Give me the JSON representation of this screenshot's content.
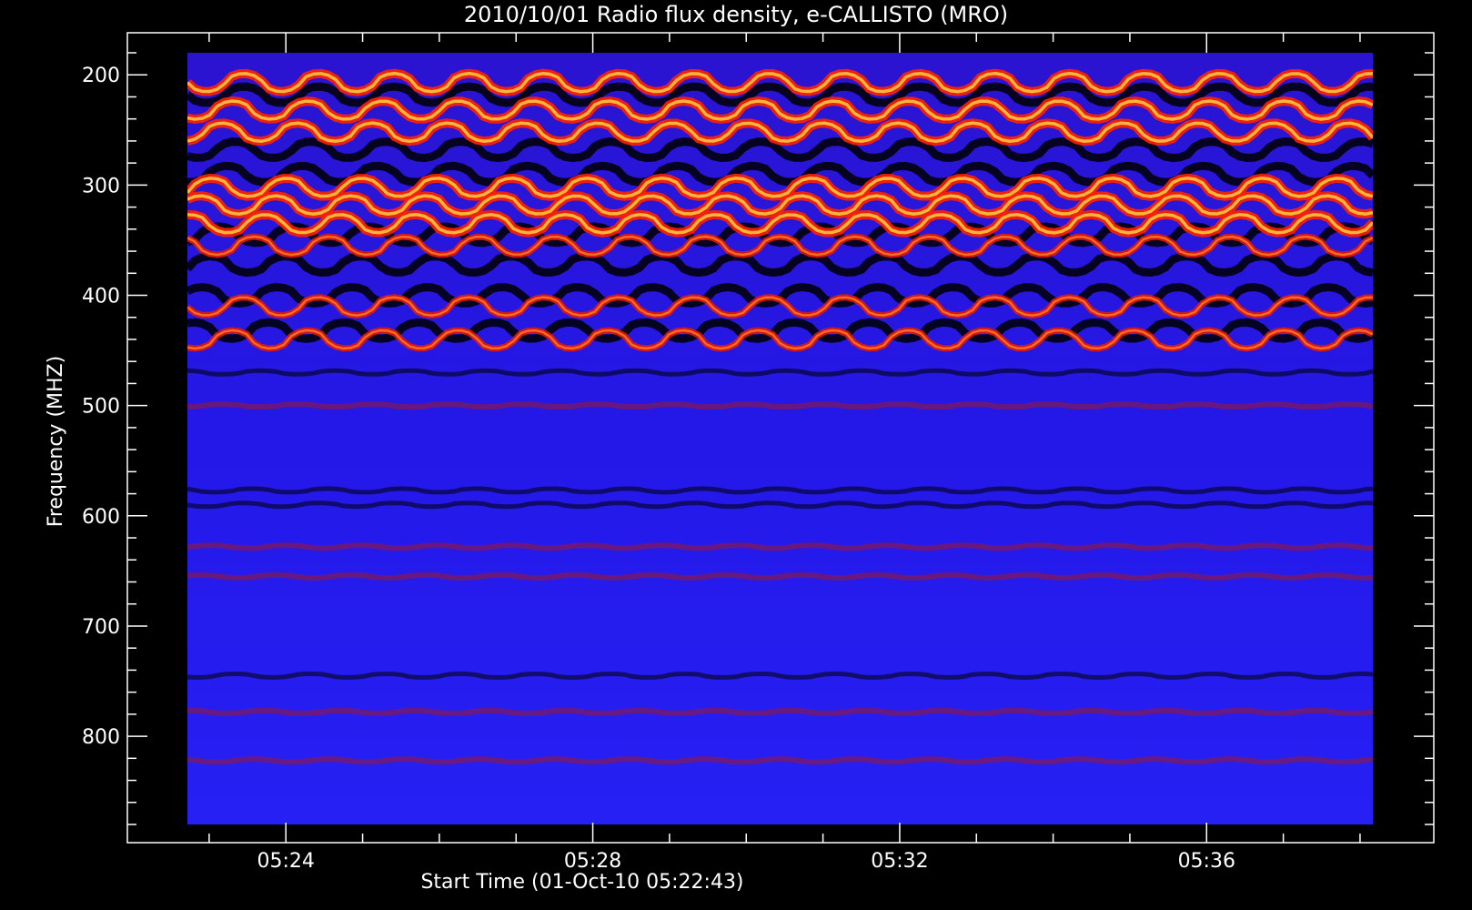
{
  "chart_data": {
    "type": "heatmap",
    "title": "2010/10/01  Radio flux density, e-CALLISTO (MRO)",
    "xlabel": "Start Time (01-Oct-10 05:22:43)",
    "ylabel": "Frequency (MHZ)",
    "x_ticks": [
      "05:24",
      "05:28",
      "05:32",
      "05:36"
    ],
    "y_ticks": [
      200,
      300,
      400,
      500,
      600,
      700,
      800
    ],
    "xlim": [
      "05:22:43",
      "05:38:10"
    ],
    "ylim": [
      880,
      180
    ],
    "y_axis_inverted": true,
    "colormap": [
      "#000000",
      "#1a00ff",
      "#ff2000",
      "#ffff60",
      "#ffffff"
    ],
    "background_color": "#2018e8",
    "emission_bands": [
      {
        "freq_mhz": 207,
        "intensity": "high"
      },
      {
        "freq_mhz": 232,
        "intensity": "high"
      },
      {
        "freq_mhz": 252,
        "intensity": "high"
      },
      {
        "freq_mhz": 302,
        "intensity": "high"
      },
      {
        "freq_mhz": 318,
        "intensity": "high"
      },
      {
        "freq_mhz": 335,
        "intensity": "high"
      },
      {
        "freq_mhz": 355,
        "intensity": "medium"
      },
      {
        "freq_mhz": 410,
        "intensity": "medium"
      },
      {
        "freq_mhz": 440,
        "intensity": "medium"
      },
      {
        "freq_mhz": 500,
        "intensity": "low"
      },
      {
        "freq_mhz": 628,
        "intensity": "low"
      },
      {
        "freq_mhz": 655,
        "intensity": "low"
      },
      {
        "freq_mhz": 778,
        "intensity": "low"
      },
      {
        "freq_mhz": 822,
        "intensity": "low"
      }
    ],
    "dark_bands_mhz": [
      218,
      268,
      290,
      345,
      372,
      400,
      432,
      470,
      577,
      590,
      745
    ]
  }
}
